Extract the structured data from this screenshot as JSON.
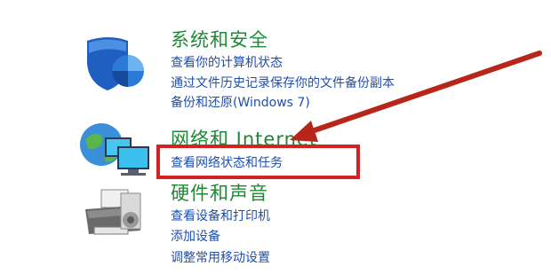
{
  "categories": [
    {
      "title": "系统和安全",
      "icon": "shield-icon",
      "links": [
        "查看你的计算机状态",
        "通过文件历史记录保存你的文件备份副本",
        "备份和还原(Windows 7)"
      ]
    },
    {
      "title": "网络和 Internet",
      "icon": "network-globe-icon",
      "links": [
        "查看网络状态和任务"
      ]
    },
    {
      "title": "硬件和声音",
      "icon": "printer-icon",
      "links": [
        "查看设备和打印机",
        "添加设备",
        "调整常用移动设置"
      ]
    }
  ],
  "annotation": {
    "box_color": "#d42222",
    "arrow_color": "#b8261a"
  },
  "colors": {
    "heading": "#1d8a34",
    "link": "#1e4fae"
  }
}
